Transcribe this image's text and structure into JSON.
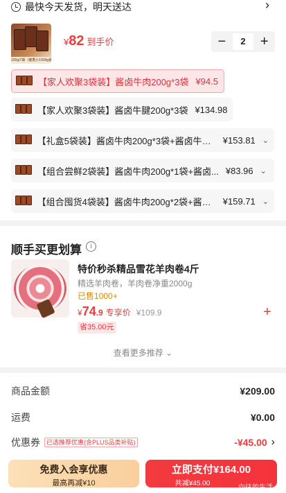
{
  "delivery": {
    "text": "最快今天发货，明天送达",
    "icon": "clock-icon"
  },
  "product": {
    "thumb_caption": "200g/7袋（酱香小1500g装）",
    "currency": "¥",
    "price": "82",
    "price_suffix": "到手价",
    "quantity": "2",
    "minus": "−",
    "plus": "+"
  },
  "options": [
    {
      "label": "【家人欢聚3袋装】酱卤牛肉200g*3袋",
      "price": "¥94.5",
      "selected": true,
      "has_chevron": false
    },
    {
      "label": "【家人欢聚3袋装】酱卤牛腱200g*3袋",
      "price": "¥134.98",
      "selected": false,
      "has_chevron": false
    },
    {
      "label": "【礼盒5袋装】酱卤牛肉200g*3袋+酱卤牛腱...",
      "price": "¥153.81",
      "selected": false,
      "has_chevron": true
    },
    {
      "label": "【组合尝鲜2袋装】酱卤牛肉200g*1袋+酱卤...",
      "price": "¥83.96",
      "selected": false,
      "has_chevron": true
    },
    {
      "label": "【组合囤货4袋装】酱卤牛肉200g*2袋+酱卤...",
      "price": "¥159.71",
      "selected": false,
      "has_chevron": true
    }
  ],
  "recommend": {
    "title": "顺手买更划算",
    "info": "i",
    "item": {
      "name": "特价秒杀精品雪花羊肉卷4斤",
      "desc": "精选羊肉卷，羊肉卷净重2000g",
      "sold": "已售1000+",
      "currency": "¥",
      "price_int": "74",
      "price_dec": ".9",
      "price_label": "专享价",
      "orig_price": "¥109.9",
      "save": "省35.00元",
      "add": "+"
    },
    "more": "查看更多推荐"
  },
  "summary": {
    "goods_label": "商品金额",
    "goods_value": "¥209.00",
    "shipping_label": "运费",
    "shipping_value": "¥0.00",
    "coupon_label": "优惠券",
    "coupon_tag": "已选推荐优惠(含PLUS品类补贴)",
    "coupon_value": "-¥45.00"
  },
  "bottom_bar": {
    "member_title": "免费入会享优惠",
    "member_sub": "最高再减¥10",
    "pay_title": "立即支付¥164.00",
    "pay_sub": "共减¥45.00",
    "watermark": "向往的生活"
  },
  "colors": {
    "accent": "#f03c3c",
    "member_gold": "#f9cf9c",
    "pay_red": "#f23a3f"
  }
}
